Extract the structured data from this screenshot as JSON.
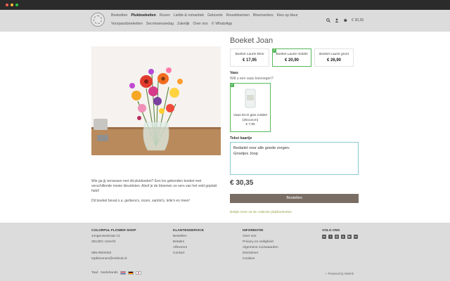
{
  "header": {
    "nav_row1": [
      "Boeketten",
      "Plukboeketten",
      "Rozen",
      "Liefde & romantiek",
      "Geboorte",
      "Rouwbloemen",
      "Bloemenbox",
      "Kies op kleur"
    ],
    "nav_row2": [
      "Voorjaarsboeketten",
      "Secretaressedag",
      "Zakelijk",
      "Over ons",
      "WhatsApp"
    ],
    "active_nav": "Plukboeketten",
    "cart_total": "€ 30,35"
  },
  "product": {
    "title": "Boeket Joan",
    "variants": [
      {
        "name": "Boeket Laurie klein",
        "price": "€ 17,95",
        "selected": false
      },
      {
        "name": "Boeket Laurie middel",
        "price": "€ 20,90",
        "selected": true
      },
      {
        "name": "Boeket Laurie groot",
        "price": "€ 26,90",
        "selected": false
      }
    ],
    "vase_label": "Vaas",
    "vase_question": "Wilt u een vaas toevoegen?",
    "vase": {
      "name_line1": "Vaas ECO glas middel",
      "name_line2": "(25x14cm)",
      "price": "€ 7,95",
      "selected": true
    },
    "card_label": "Tekst kaartje",
    "card_text": "Bedankt voor alle goede zorgen.\nGroetjes Joop",
    "total_price": "€ 30,35",
    "order_button": "Bestellen",
    "collection_link": "Bekijk meer uit de collectie plukboeketten",
    "description_p1": "Wie ga jij verrassen met dit plukboeket? Een los gebonden boeket met verschillende mooie kleurtinten. Alsof je de bloemen zo vers van het veld geplukt hebt!",
    "description_p2": "Dit boeket bevat o.a. gerbera's, rozen, santini's, lelie's en meer!"
  },
  "footer": {
    "shop": {
      "heading": "COLORFUL FLOWER SHOP",
      "address1": "Jongenwestraat 13",
      "address2": "3513DC Utrecht",
      "phone": "085-0603452",
      "email": "topbloemen@midmid.nl"
    },
    "service": {
      "heading": "KLANTENSERVICE",
      "items": [
        "Bestellen",
        "Betalen",
        "Afleveren",
        "Contact"
      ]
    },
    "info": {
      "heading": "INFORMATIE",
      "items": [
        "Over ons",
        "Privacy en veiligheid",
        "Algemene voorwaarden",
        "Disclaimer",
        "Cookies"
      ]
    },
    "social": {
      "heading": "VOLG ONS",
      "icons": [
        "linkedin-square-icon",
        "twitter-icon",
        "instagram-icon",
        "pinterest-icon",
        "youtube-icon",
        "linkedin-icon"
      ]
    },
    "language_label": "Taal:",
    "language_value": "Nederlands",
    "powered_by": "Powered by Webriti"
  },
  "colors": {
    "accent_green": "#57b85d",
    "button": "#7a6e64",
    "link": "#9aa14a",
    "header_bg": "#dcdcdc"
  }
}
